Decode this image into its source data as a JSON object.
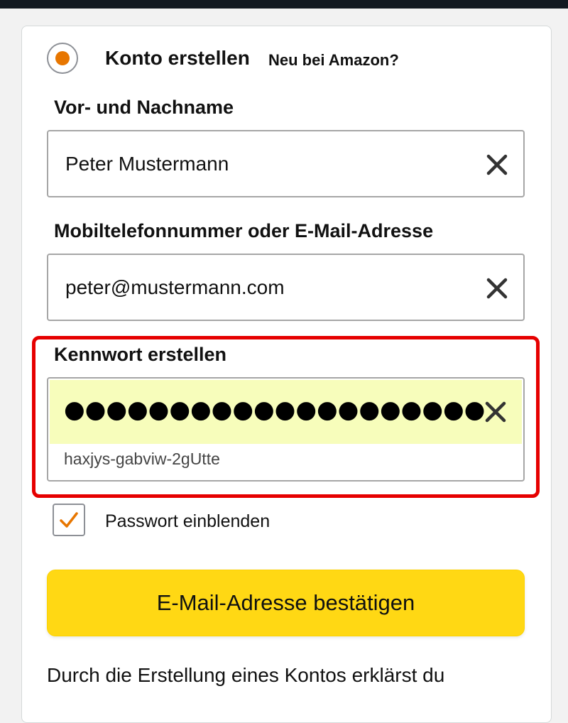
{
  "account_option": {
    "title": "Konto erstellen",
    "subtitle": "Neu bei Amazon?",
    "selected": true
  },
  "name_field": {
    "label": "Vor- und Nachname",
    "value": "Peter Mustermann",
    "clear_icon": "close-icon"
  },
  "contact_field": {
    "label": "Mobiltelefonnummer oder E-Mail-Adresse",
    "value": "peter@mustermann.com",
    "clear_icon": "close-icon"
  },
  "password_field": {
    "label": "Kennwort erstellen",
    "masked_value": "●●●●●●●●●●●●●●●●●●●●",
    "suggestion": "haxjys-gabviw-2gUtte",
    "clear_icon": "close-icon",
    "fill_color": "#f7fdbb"
  },
  "show_password": {
    "label": "Passwort einblenden",
    "checked": true
  },
  "primary_button": {
    "label": "E-Mail-Adresse bestätigen",
    "color": "#ffd814"
  },
  "legal_text": "Durch die Erstellung eines Kontos erklärst du",
  "colors": {
    "accent": "#e77600",
    "highlight_border": "#e60000",
    "top_bar": "#131921"
  }
}
